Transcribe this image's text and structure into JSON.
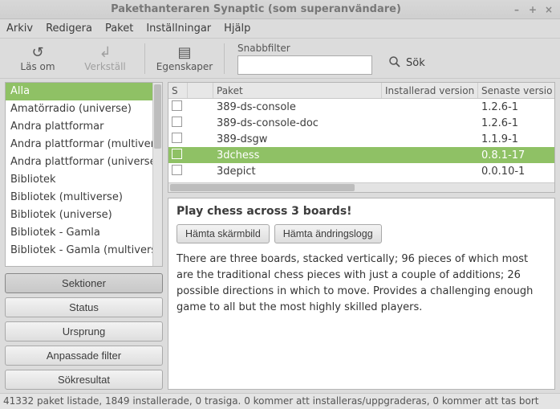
{
  "window": {
    "title": "Pakethanteraren Synaptic  (som superanvändare)"
  },
  "menu": {
    "items": [
      "Arkiv",
      "Redigera",
      "Paket",
      "Inställningar",
      "Hjälp"
    ]
  },
  "toolbar": {
    "reload": "Läs om",
    "apply": "Verkställ",
    "properties": "Egenskaper",
    "quickfilter_label": "Snabbfilter",
    "quickfilter_value": "",
    "search": "Sök"
  },
  "categories": [
    "Alla",
    "Amatörradio (universe)",
    "Andra plattformar",
    "Andra plattformar (multiverse)",
    "Andra plattformar (universe)",
    "Bibliotek",
    "Bibliotek (multiverse)",
    "Bibliotek (universe)",
    "Bibliotek - Gamla",
    "Bibliotek - Gamla (multiverse)"
  ],
  "category_selected_index": 0,
  "viewbuttons": {
    "sections": "Sektioner",
    "status": "Status",
    "origin": "Ursprung",
    "custom": "Anpassade filter",
    "results": "Sökresultat"
  },
  "pkgtable": {
    "headers": {
      "s": "S",
      "blank": "",
      "package": "Paket",
      "installed": "Installerad version",
      "latest": "Senaste versio"
    },
    "rows": [
      {
        "name": "389-ds-console",
        "installed": "",
        "latest": "1.2.6-1"
      },
      {
        "name": "389-ds-console-doc",
        "installed": "",
        "latest": "1.2.6-1"
      },
      {
        "name": "389-dsgw",
        "installed": "",
        "latest": "1.1.9-1"
      },
      {
        "name": "3dchess",
        "installed": "",
        "latest": "0.8.1-17"
      },
      {
        "name": "3depict",
        "installed": "",
        "latest": "0.0.10-1"
      }
    ],
    "selected_index": 3
  },
  "description": {
    "title": "Play chess across 3 boards!",
    "screenshot_btn": "Hämta skärmbild",
    "changelog_btn": "Hämta ändringslogg",
    "body": "There are three boards, stacked vertically; 96 pieces of which most are the traditional chess pieces with just a couple of additions; 26 possible directions in which to move. Provides a challenging enough game to all but the most highly skilled players."
  },
  "statusbar": "41332 paket listade, 1849 installerade, 0 trasiga. 0 kommer att installeras/uppgraderas, 0 kommer att tas bort"
}
